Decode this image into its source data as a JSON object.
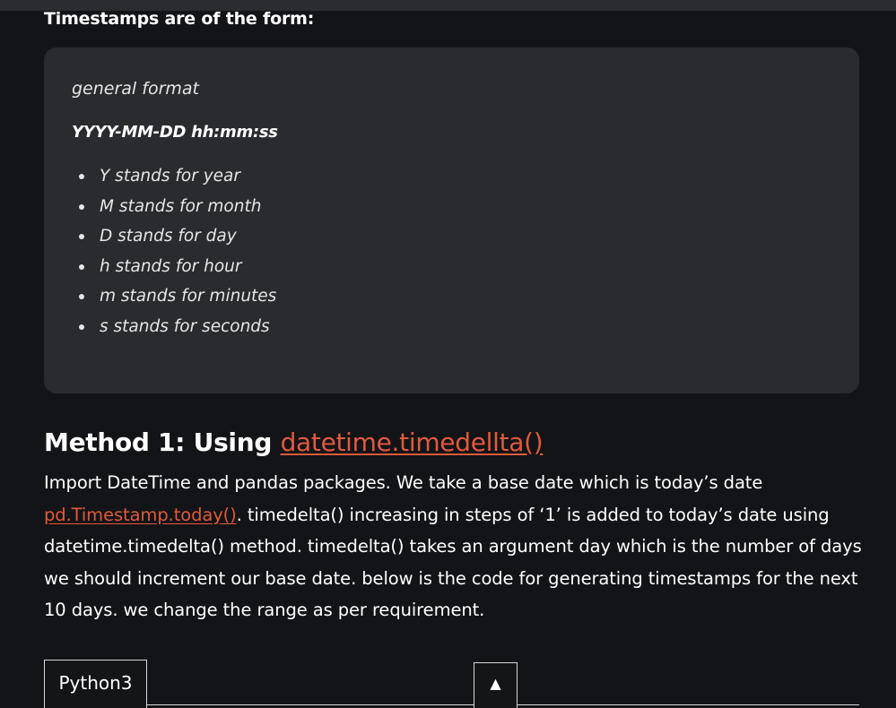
{
  "section": {
    "intro": "Timestamps are of the form:"
  },
  "format_box": {
    "label": "general format",
    "pattern": "YYYY-MM-DD hh:mm:ss",
    "items": [
      "Y stands for year",
      "M stands for month",
      "D  stands for day",
      "h  stands for hour",
      "m  stands for minutes",
      "s  stands for seconds"
    ]
  },
  "method": {
    "title_prefix": "Method 1: Using ",
    "title_link": "datetime.timedellta()",
    "para_line1": "Import DateTime and pandas packages. We take a base date which is today’s date",
    "para_link": "pd.Timestamp.today()",
    "para_line2_rest": ". timedelta() increasing in steps of ‘1’ is added to today’s date using",
    "para_line3": "datetime.timedelta() method. timedelta() takes an argument day which is the number of days",
    "para_line4": "we should increment our base date. below is the code for generating timestamps for the next",
    "para_line5": "10 days. we change the range as per requirement."
  },
  "code_tabs": {
    "active_tab": "Python3",
    "collapse_icon": "▲"
  }
}
